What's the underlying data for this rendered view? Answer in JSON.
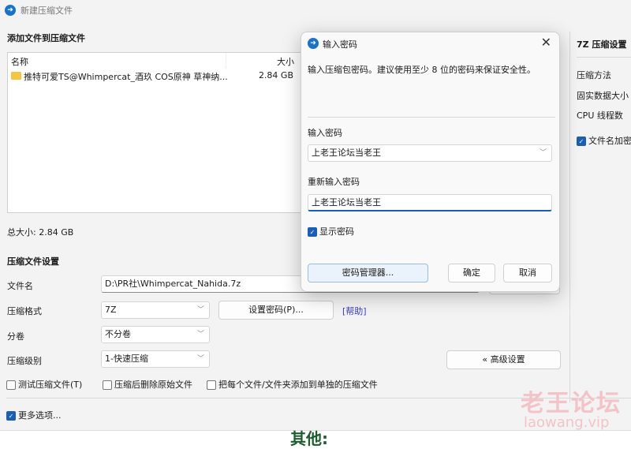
{
  "window": {
    "title": "新建压缩文件"
  },
  "files": {
    "heading": "添加文件到压缩文件",
    "col_name": "名称",
    "col_size": "大小",
    "items": [
      {
        "name": "推特可爱TS@Whimpercat_酒玖 COS原神 草神纳...",
        "size": "2.84 GB",
        "icon": "folder-icon"
      }
    ],
    "total": "总大小: 2.84 GB"
  },
  "settings": {
    "heading": "压缩文件设置",
    "filename_label": "文件名",
    "filename_value": "D:\\PR社\\Whimpercat_Nahida.7z",
    "format_label": "压缩格式",
    "format_value": "7Z",
    "set_password": "设置密码(P)...",
    "help": "[帮助]",
    "split_label": "分卷",
    "split_value": "不分卷",
    "level_label": "压缩级别",
    "level_value": "1-快速压缩",
    "advanced": "« 高级设置",
    "opt_test": "测试压缩文件(T)",
    "opt_delete": "压缩后删除原始文件",
    "opt_each": "把每个文件/文件夹添加到单独的压缩文件",
    "more": "更多选项..."
  },
  "right": {
    "heading": "7Z 压缩设置",
    "method": "压缩方法",
    "solid": "固实数据大小",
    "cpu": "CPU 线程数",
    "encrypt_names": "文件名加密"
  },
  "dialog": {
    "title": "输入密码",
    "desc": "输入压缩包密码。建议使用至少 8 位的密码来保证安全性。",
    "pw_label": "输入密码",
    "pw_value": "上老王论坛当老王",
    "pw2_label": "重新输入密码",
    "pw2_value": "上老王论坛当老王",
    "show": "显示密码",
    "manager": "密码管理器...",
    "ok": "确定",
    "cancel": "取消"
  },
  "background": {
    "text": "其他:"
  },
  "watermark": {
    "line1": "老王论坛",
    "line2": "laowang.vip"
  },
  "colors": {
    "accent": "#1a5fb4",
    "link": "#3b3bd0"
  }
}
